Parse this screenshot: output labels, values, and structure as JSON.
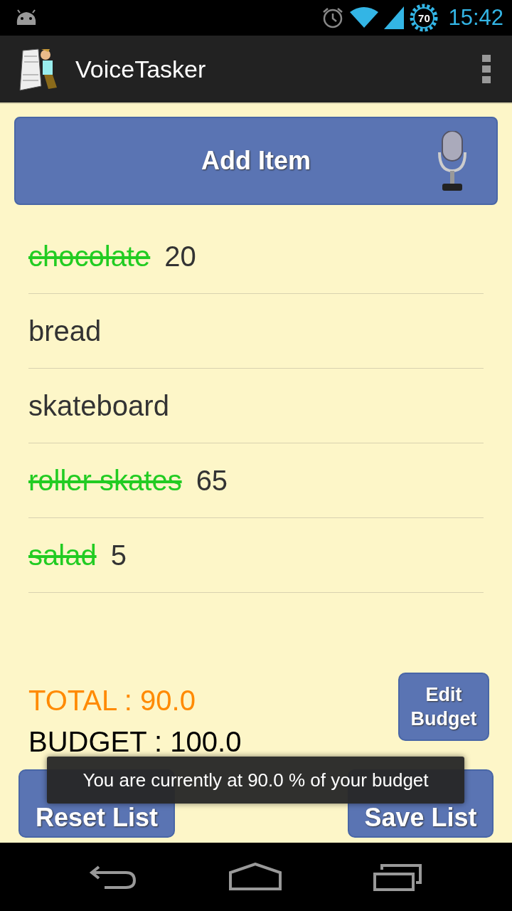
{
  "status_bar": {
    "battery": "70",
    "time": "15:42"
  },
  "action_bar": {
    "title": "VoiceTasker"
  },
  "add_button": {
    "label": "Add Item"
  },
  "items": [
    {
      "name": "chocolate",
      "price": "20",
      "checked": true
    },
    {
      "name": "bread",
      "checked": false
    },
    {
      "name": "skateboard",
      "checked": false
    },
    {
      "name": "roller skates",
      "price": "65",
      "checked": true
    },
    {
      "name": "salad",
      "price": "5",
      "checked": true
    }
  ],
  "total": "TOTAL : 90.0",
  "budget": "BUDGET : 100.0",
  "edit_budget_button": {
    "label": "Edit Budget"
  },
  "reset_button": {
    "label": "Reset List"
  },
  "save_button": {
    "label": "Save List"
  },
  "toast": "You are currently at 90.0 % of your budget"
}
